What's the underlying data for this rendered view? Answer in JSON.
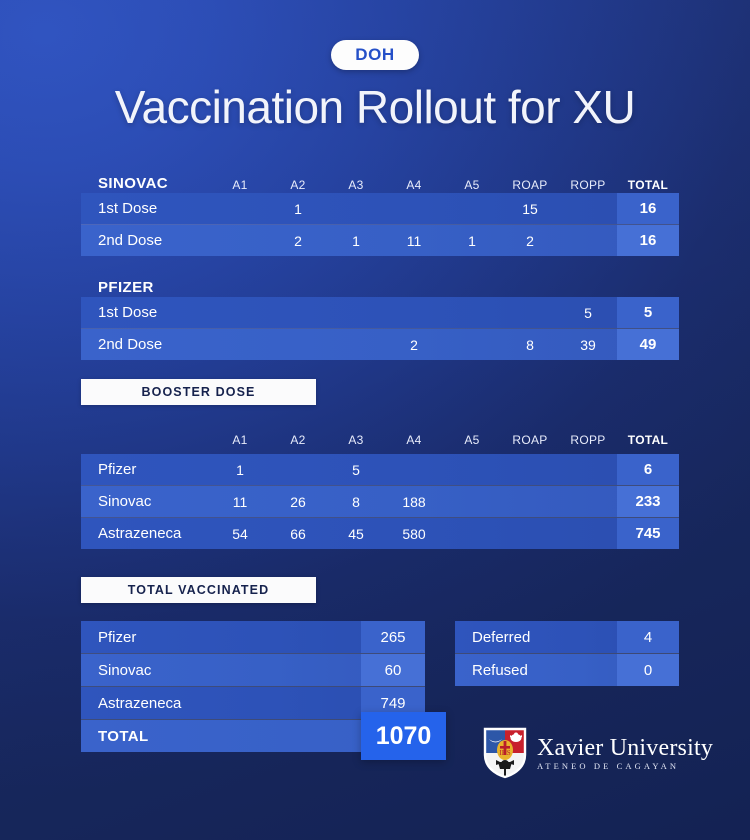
{
  "header": {
    "badge": "DOH",
    "title": "Vaccination Rollout for XU"
  },
  "columns": [
    "A1",
    "A2",
    "A3",
    "A4",
    "A5",
    "ROAP",
    "ROPP",
    "TOTAL"
  ],
  "sections": {
    "sinovac": {
      "name": "SINOVAC",
      "rows": [
        {
          "label": "1st Dose",
          "cells": [
            "",
            "1",
            "",
            "",
            "",
            "15",
            ""
          ],
          "total": "16"
        },
        {
          "label": "2nd Dose",
          "cells": [
            "",
            "2",
            "1",
            "11",
            "1",
            "2",
            ""
          ],
          "total": "16"
        }
      ]
    },
    "pfizer": {
      "name": "PFIZER",
      "rows": [
        {
          "label": "1st Dose",
          "cells": [
            "",
            "",
            "",
            "",
            "",
            "",
            "5"
          ],
          "total": "5"
        },
        {
          "label": "2nd Dose",
          "cells": [
            "",
            "",
            "",
            "2",
            "",
            "8",
            "39"
          ],
          "total": "49"
        }
      ]
    },
    "booster": {
      "chip": "BOOSTER DOSE",
      "rows": [
        {
          "label": "Pfizer",
          "cells": [
            "1",
            "",
            "5",
            "",
            "",
            "",
            ""
          ],
          "total": "6"
        },
        {
          "label": "Sinovac",
          "cells": [
            "11",
            "26",
            "8",
            "188",
            "",
            "",
            ""
          ],
          "total": "233"
        },
        {
          "label": "Astrazeneca",
          "cells": [
            "54",
            "66",
            "45",
            "580",
            "",
            "",
            ""
          ],
          "total": "745"
        }
      ]
    },
    "total_vaccinated": {
      "chip": "TOTAL VACCINATED",
      "rows": [
        {
          "label": "Pfizer",
          "value": "265"
        },
        {
          "label": "Sinovac",
          "value": "60"
        },
        {
          "label": "Astrazeneca",
          "value": "749"
        }
      ],
      "grand_label": "TOTAL",
      "grand_value": "1070"
    },
    "status": {
      "rows": [
        {
          "label": "Deferred",
          "value": "4"
        },
        {
          "label": "Refused",
          "value": "0"
        }
      ]
    }
  },
  "logo": {
    "name": "Xavier University",
    "tagline": "ATENEO DE CAGAYAN"
  },
  "colors": {
    "background_top": "#2a4ab0",
    "background_bottom": "#192a62",
    "row_light": "#3a63cb",
    "row_dark": "#2d52b8",
    "total_highlight": "#2563eb",
    "chip_background": "#fbfbfc",
    "badge_text": "#2550c8"
  }
}
